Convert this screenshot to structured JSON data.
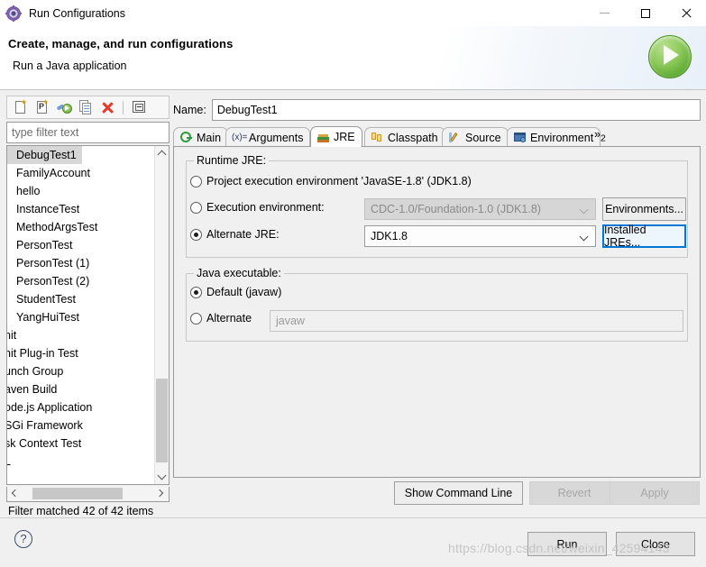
{
  "window": {
    "title": "Run Configurations",
    "icon": "run-configurations-icon",
    "minimize_label": "",
    "maximize_label": "",
    "close_label": ""
  },
  "banner": {
    "title": "Create, manage, and run configurations",
    "subtitle": "Run a Java application",
    "badge_icon": "green-run-play-icon"
  },
  "left_panel": {
    "toolbar": [
      {
        "name": "new-configuration-icon",
        "tooltip": "New launch configuration"
      },
      {
        "name": "new-prototype-icon",
        "tooltip": "New prototype"
      },
      {
        "name": "export-run-icon",
        "tooltip": "Export"
      },
      {
        "name": "duplicate-icon",
        "tooltip": "Duplicate"
      },
      {
        "name": "delete-icon",
        "tooltip": "Delete"
      },
      {
        "name": "collapse-all-icon",
        "tooltip": "Collapse All"
      }
    ],
    "filter_placeholder": "type filter text",
    "filter_value": "",
    "items": [
      {
        "label": "DebugTest1",
        "selected": true,
        "clipped": false
      },
      {
        "label": "FamilyAccount",
        "selected": false,
        "clipped": false
      },
      {
        "label": "hello",
        "selected": false,
        "clipped": false
      },
      {
        "label": "InstanceTest",
        "selected": false,
        "clipped": false
      },
      {
        "label": "MethodArgsTest",
        "selected": false,
        "clipped": false
      },
      {
        "label": "PersonTest",
        "selected": false,
        "clipped": false
      },
      {
        "label": "PersonTest (1)",
        "selected": false,
        "clipped": false
      },
      {
        "label": "PersonTest (2)",
        "selected": false,
        "clipped": false
      },
      {
        "label": "StudentTest",
        "selected": false,
        "clipped": false
      },
      {
        "label": "YangHuiTest",
        "selected": false,
        "clipped": false
      },
      {
        "label": "nit",
        "selected": false,
        "clipped": true
      },
      {
        "label": "nit Plug-in Test",
        "selected": false,
        "clipped": true
      },
      {
        "label": "unch Group",
        "selected": false,
        "clipped": true
      },
      {
        "label": "aven Build",
        "selected": false,
        "clipped": true
      },
      {
        "label": "ode.js Application",
        "selected": false,
        "clipped": true
      },
      {
        "label": "SGi Framework",
        "selected": false,
        "clipped": true
      },
      {
        "label": "sk Context Test",
        "selected": false,
        "clipped": true
      },
      {
        "label": "L",
        "selected": false,
        "clipped": true
      }
    ],
    "status": "Filter matched 42 of 42 items"
  },
  "main": {
    "name_label": "Name:",
    "name_value": "DebugTest1",
    "tabs": [
      {
        "label": "Main",
        "icon": "java-main-icon",
        "active": false
      },
      {
        "label": "Arguments",
        "icon": "arguments-icon",
        "active": false
      },
      {
        "label": "JRE",
        "icon": "jre-books-icon",
        "active": true
      },
      {
        "label": "Classpath",
        "icon": "classpath-icon",
        "active": false
      },
      {
        "label": "Source",
        "icon": "source-icon",
        "active": false
      },
      {
        "label": "Environment",
        "icon": "environment-icon",
        "active": false
      }
    ],
    "tab_overflow": "»",
    "tab_overflow_count": "2",
    "runtime_jre": {
      "group_label": "Runtime JRE:",
      "option_project": {
        "label": "Project execution environment 'JavaSE-1.8' (JDK1.8)",
        "selected": false
      },
      "option_execution_env": {
        "label": "Execution environment:",
        "selected": false,
        "combo_value": "CDC-1.0/Foundation-1.0 (JDK1.8)",
        "combo_disabled": true,
        "button_label": "Environments..."
      },
      "option_alternate_jre": {
        "label": "Alternate JRE:",
        "selected": true,
        "combo_value": "JDK1.8",
        "combo_disabled": false,
        "button_label": "Installed JREs...",
        "button_focused": true
      }
    },
    "java_executable": {
      "group_label": "Java executable:",
      "option_default": {
        "label": "Default (javaw)",
        "selected": true
      },
      "option_alternate": {
        "label": "Alternate",
        "selected": false,
        "input_placeholder": "javaw",
        "input_value": ""
      }
    },
    "actions": [
      {
        "label": "Show Command Line",
        "disabled": false
      },
      {
        "label": "Revert",
        "disabled": true
      },
      {
        "label": "Apply",
        "disabled": true
      }
    ]
  },
  "footer": {
    "help_icon": "help-question-icon",
    "run_button": "Run",
    "close_button": "Close",
    "watermark": "https://blog.csdn.net/weixin_42594143"
  },
  "colors": {
    "accent_focus": "#0078d7",
    "run_green": "#5aa62f",
    "delete_red": "#e33a2e",
    "panel_bg": "#f0f0f0",
    "selection_gray": "#d6d6d6"
  }
}
